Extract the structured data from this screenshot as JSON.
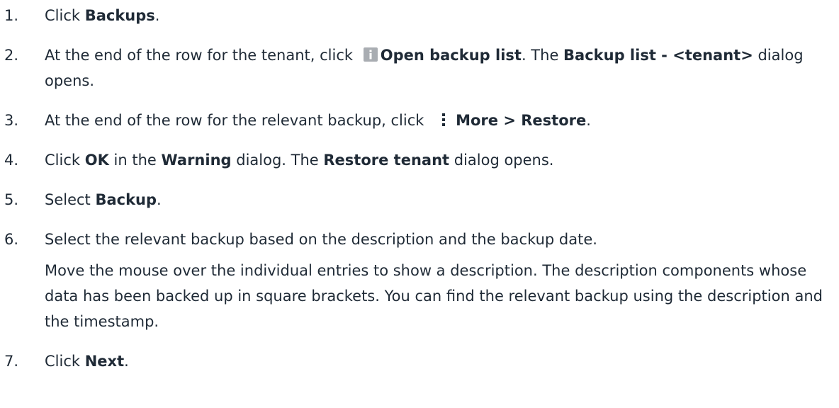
{
  "steps": [
    {
      "number": "1.",
      "parts": [
        "Click ",
        "Backups",
        "."
      ]
    },
    {
      "number": "2.",
      "parts": [
        "At the end of the row for the tenant, click ",
        "Open backup list",
        ". The ",
        "Backup list - <tenant>",
        " dialog opens."
      ],
      "icon": "info-icon"
    },
    {
      "number": "3.",
      "parts": [
        "At the end of the row for the relevant backup, click ",
        "More > Restore",
        "."
      ],
      "icon": "more-vertical-icon"
    },
    {
      "number": "4.",
      "parts": [
        "Click ",
        "OK",
        " in the ",
        "Warning",
        " dialog. The ",
        "Restore tenant",
        " dialog opens."
      ]
    },
    {
      "number": "5.",
      "parts": [
        "Select ",
        "Backup",
        "."
      ]
    },
    {
      "number": "6.",
      "parts": [
        "Select the relevant backup based on the description and the backup date."
      ],
      "note": "Move the mouse over the individual entries to show a description. The description components whose data has been backed up in square brackets. You can find the relevant backup using the description and the timestamp."
    },
    {
      "number": "7.",
      "parts": [
        "Click ",
        "Next",
        "."
      ]
    }
  ],
  "colors": {
    "text": "#1f2a36",
    "icon": "#a9adb2"
  }
}
